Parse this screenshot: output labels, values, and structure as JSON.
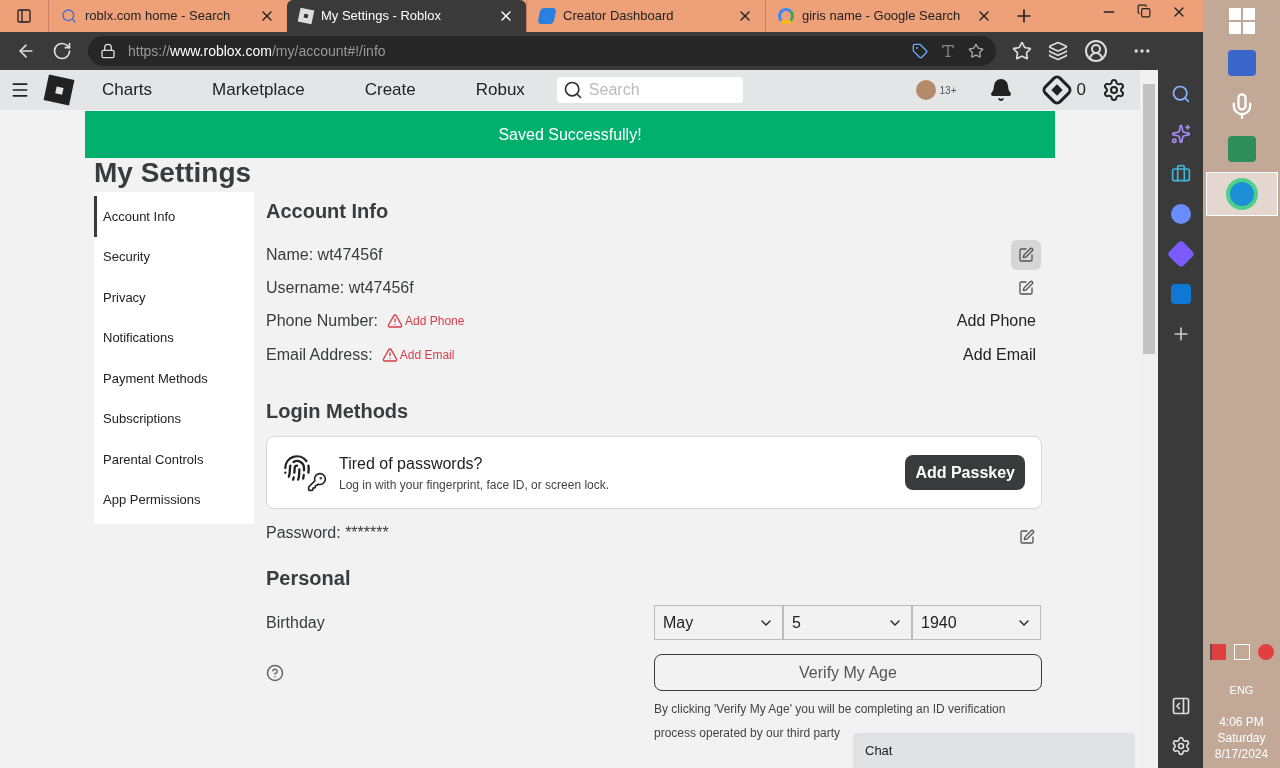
{
  "browser": {
    "tabs": [
      {
        "title": "roblx.com home - Search",
        "kind": "search",
        "selected": false
      },
      {
        "title": "My Settings - Roblox",
        "kind": "roblox",
        "selected": true
      },
      {
        "title": "Creator Dashboard",
        "kind": "studio",
        "selected": false
      },
      {
        "title": "giris name - Google Search",
        "kind": "google",
        "selected": false
      }
    ],
    "url_scheme": "https://",
    "url_host": "www.roblox.com",
    "url_path": "/my/account#!/info"
  },
  "nav": {
    "links": [
      "Charts",
      "Marketplace",
      "Create",
      "Robux"
    ],
    "search": {
      "placeholder": "Search"
    },
    "age_badge": "13+",
    "robux": "0"
  },
  "banner": "Saved Successfully!",
  "page_title": "My Settings",
  "sidebar": {
    "items": [
      {
        "label": "Account Info",
        "selected": true
      },
      {
        "label": "Security",
        "selected": false
      },
      {
        "label": "Privacy",
        "selected": false
      },
      {
        "label": "Notifications",
        "selected": false
      },
      {
        "label": "Payment Methods",
        "selected": false
      },
      {
        "label": "Subscriptions",
        "selected": false
      },
      {
        "label": "Parental Controls",
        "selected": false
      },
      {
        "label": "App Permissions",
        "selected": false
      }
    ]
  },
  "account_info": {
    "title": "Account Info",
    "fields": [
      {
        "kind": "value",
        "label": "Name: wt47456f",
        "highlighted": true
      },
      {
        "kind": "value",
        "label": "Username: wt47456f",
        "highlighted": false
      },
      {
        "kind": "missing",
        "label": "Phone Number:",
        "warning": "Add Phone",
        "action": "Add Phone"
      },
      {
        "kind": "missing",
        "label": "Email Address:",
        "warning": "Add Email",
        "action": "Add Email"
      }
    ]
  },
  "login_methods": {
    "title": "Login Methods",
    "card_title": "Tired of passwords?",
    "card_text": "Log in with your fingerprint, face ID, or screen lock.",
    "button": "Add Passkey",
    "password": "Password: *******"
  },
  "personal": {
    "title": "Personal",
    "birthday_label": "Birthday",
    "month": "May",
    "day": "5",
    "year": "1940",
    "verify_button": "Verify My Age",
    "disclaimer_lines": [
      "By clicking 'Verify My Age' you will be completing an ID verification",
      "process operated by our third party"
    ]
  },
  "chat": {
    "title": "Chat"
  },
  "taskbar": {
    "language": "ENG",
    "time": "4:06 PM",
    "day": "Saturday",
    "date": "8/17/2024"
  }
}
